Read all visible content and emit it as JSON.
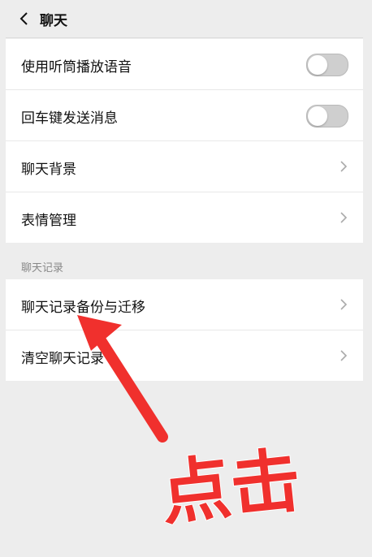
{
  "header": {
    "title": "聊天",
    "back_icon": "chevron-left-icon"
  },
  "settings": {
    "voice_earpiece": {
      "label": "使用听筒播放语音",
      "on": false
    },
    "enter_send": {
      "label": "回车键发送消息",
      "on": false
    },
    "chat_background": {
      "label": "聊天背景"
    },
    "sticker_manage": {
      "label": "表情管理"
    }
  },
  "history_section": {
    "title": "聊天记录",
    "backup_migrate": {
      "label": "聊天记录备份与迁移"
    },
    "clear_history": {
      "label": "清空聊天记录"
    }
  },
  "annotation": {
    "text": "点击",
    "color": "#f0302d",
    "arrow_icon": "red-arrow-icon"
  }
}
